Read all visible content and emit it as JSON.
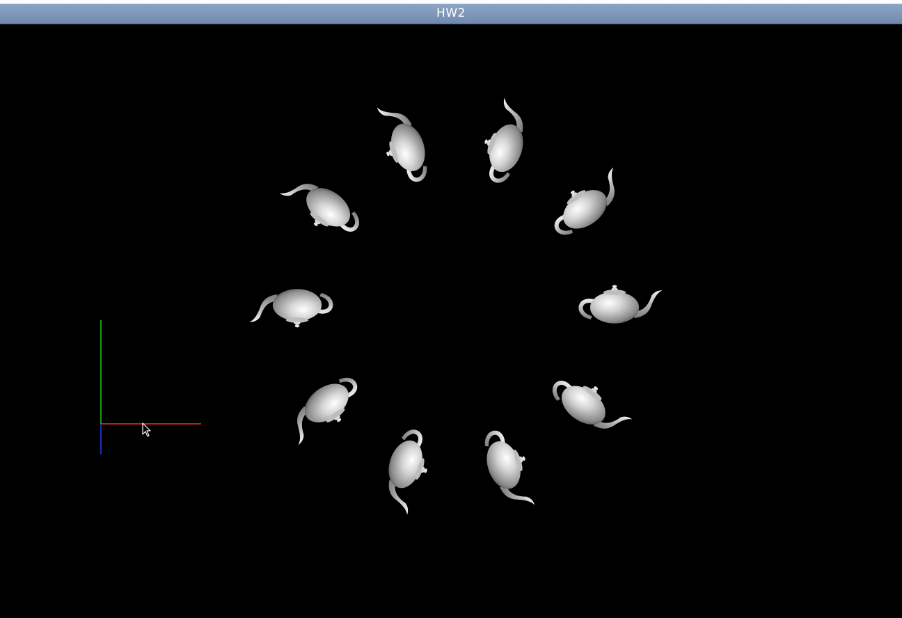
{
  "window": {
    "title": "HW2"
  },
  "scene": {
    "background": "#000000",
    "object_count": 10,
    "object_type": "teapot-icon",
    "axis_colors": {
      "x": "#ff2a2a",
      "y": "#22cc22",
      "z": "#2a3cff"
    },
    "teapot_color": "#c8c8c8"
  }
}
